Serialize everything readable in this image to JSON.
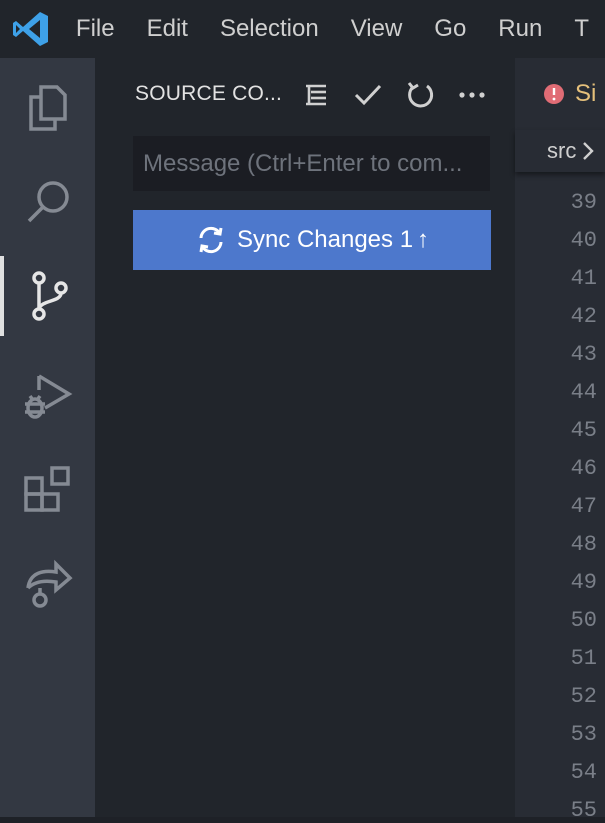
{
  "menu": [
    "File",
    "Edit",
    "Selection",
    "View",
    "Go",
    "Run",
    "T"
  ],
  "activity_bar": [
    "explorer-icon",
    "search-icon",
    "source-control-icon",
    "run-debug-icon",
    "extensions-icon",
    "remote-explorer-icon"
  ],
  "sidebar": {
    "title": "SOURCE CO...",
    "message_placeholder": "Message (Ctrl+Enter to com...",
    "sync_label": "Sync Changes 1",
    "sync_arrow": "↑"
  },
  "editor": {
    "tab_label": "Si",
    "breadcrumb": "src",
    "line_numbers": [
      "39",
      "40",
      "41",
      "42",
      "43",
      "44",
      "45",
      "46",
      "47",
      "48",
      "49",
      "50",
      "51",
      "52",
      "53",
      "54",
      "55"
    ]
  },
  "colors": {
    "accent_button": "#4d78cc",
    "tab_error": "#e06c75",
    "tab_text": "#e5c07b",
    "vscode_blue": "#3ea1e8"
  }
}
